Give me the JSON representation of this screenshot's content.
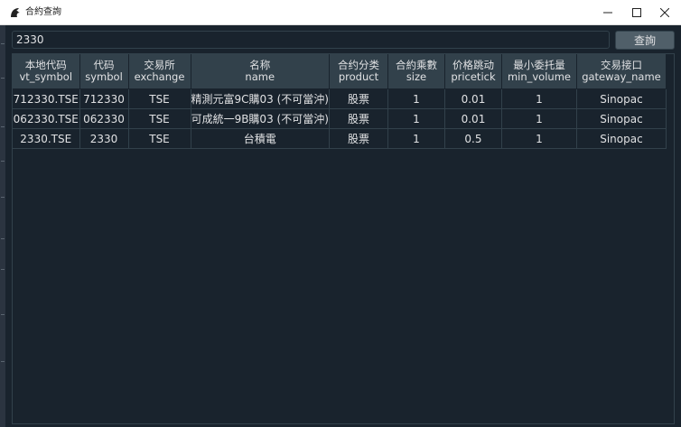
{
  "window": {
    "title": "合約查詢",
    "icon": "app-logo-icon",
    "controls": [
      "minimize-icon",
      "maximize-icon",
      "close-icon"
    ]
  },
  "search": {
    "value": "2330",
    "button_label": "查詢"
  },
  "table": {
    "columns": [
      {
        "label": "本地代码",
        "key": "vt_symbol"
      },
      {
        "label": "代码",
        "key": "symbol"
      },
      {
        "label": "交易所",
        "key": "exchange"
      },
      {
        "label": "名称",
        "key": "name"
      },
      {
        "label": "合约分类",
        "key": "product"
      },
      {
        "label": "合約乘數",
        "key": "size"
      },
      {
        "label": "价格跳动",
        "key": "pricetick"
      },
      {
        "label": "最小委托量",
        "key": "min_volume"
      },
      {
        "label": "交易接口",
        "key": "gateway_name"
      }
    ],
    "rows": [
      [
        "712330.TSE",
        "712330",
        "TSE",
        "精測元富9C購03 (不可當沖)",
        "股票",
        "1",
        "0.01",
        "1",
        "Sinopac"
      ],
      [
        "062330.TSE",
        "062330",
        "TSE",
        "可成統一9B購03 (不可當沖)",
        "股票",
        "1",
        "0.01",
        "1",
        "Sinopac"
      ],
      [
        "2330.TSE",
        "2330",
        "TSE",
        "台積電",
        "股票",
        "1",
        "0.5",
        "1",
        "Sinopac"
      ]
    ]
  },
  "colors": {
    "background": "#19232d",
    "header": "#32414b",
    "button": "#505f69",
    "text": "#e0e1e3"
  }
}
